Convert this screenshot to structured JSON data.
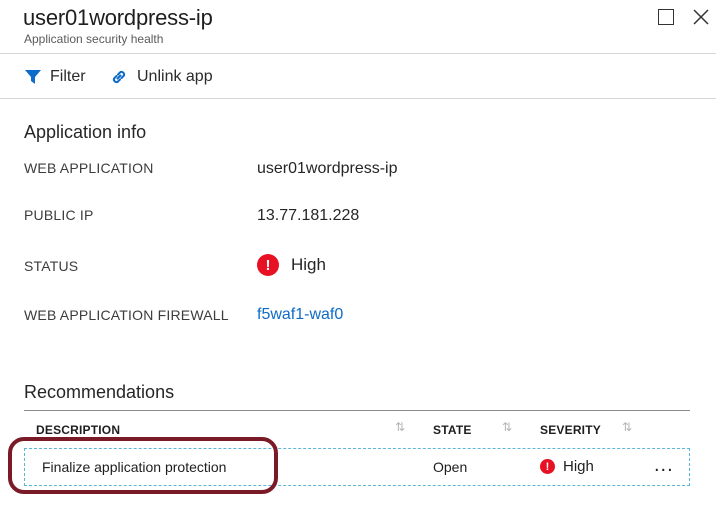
{
  "header": {
    "title": "user01wordpress-ip",
    "subtitle": "Application security health"
  },
  "toolbar": {
    "filter_label": "Filter",
    "unlink_label": "Unlink app"
  },
  "info": {
    "section_title": "Application info",
    "web_application_label": "WEB APPLICATION",
    "web_application_value": "user01wordpress-ip",
    "public_ip_label": "PUBLIC IP",
    "public_ip_value": "13.77.181.228",
    "status_label": "STATUS",
    "status_value": "High",
    "waf_label": "WEB APPLICATION FIREWALL",
    "waf_value": "f5waf1-waf0"
  },
  "recommendations": {
    "section_title": "Recommendations",
    "columns": {
      "description": "DESCRIPTION",
      "state": "STATE",
      "severity": "SEVERITY"
    },
    "rows": [
      {
        "description": "Finalize application protection",
        "state": "Open",
        "severity": "High"
      }
    ],
    "more_label": "..."
  },
  "colors": {
    "severity_high": "#e81123",
    "link": "#0d6bc9",
    "annotation": "#7b1a27",
    "row_border": "#5bb6d9"
  },
  "icons": [
    "filter-icon",
    "link-icon",
    "error-icon",
    "sort-icon",
    "maximize-icon",
    "close-icon",
    "more-icon"
  ]
}
